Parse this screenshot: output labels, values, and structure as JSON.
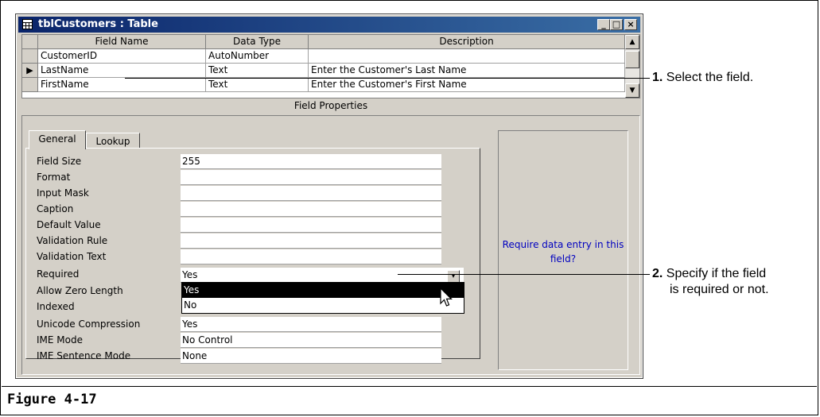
{
  "window": {
    "title": "tblCustomers : Table",
    "minimize_glyph": "_",
    "maximize_glyph": "□",
    "close_glyph": "×"
  },
  "grid": {
    "columns": [
      "Field Name",
      "Data Type",
      "Description"
    ],
    "rows": [
      {
        "field": "CustomerID",
        "type": "AutoNumber",
        "desc": ""
      },
      {
        "field": "LastName",
        "type": "Text",
        "desc": "Enter the Customer's Last Name"
      },
      {
        "field": "FirstName",
        "type": "Text",
        "desc": "Enter the Customer's First Name"
      }
    ],
    "current_row_marker": "▶",
    "scroll_up_glyph": "▲",
    "scroll_down_glyph": "▼"
  },
  "field_properties_label": "Field Properties",
  "tabs": [
    "General",
    "Lookup"
  ],
  "properties": [
    {
      "label": "Field Size",
      "value": "255"
    },
    {
      "label": "Format",
      "value": ""
    },
    {
      "label": "Input Mask",
      "value": ""
    },
    {
      "label": "Caption",
      "value": ""
    },
    {
      "label": "Default Value",
      "value": ""
    },
    {
      "label": "Validation Rule",
      "value": ""
    },
    {
      "label": "Validation Text",
      "value": ""
    },
    {
      "label": "Required",
      "value": "Yes"
    },
    {
      "label": "Allow Zero Length",
      "value": ""
    },
    {
      "label": "Indexed",
      "value": ""
    },
    {
      "label": "Unicode Compression",
      "value": "Yes"
    },
    {
      "label": "IME Mode",
      "value": "No Control"
    },
    {
      "label": "IME Sentence Mode",
      "value": "None"
    }
  ],
  "dropdown": {
    "button_glyph": "▾",
    "options": [
      "Yes",
      "No"
    ],
    "selected": "Yes"
  },
  "help_text": "Require data entry in this field?",
  "callouts": [
    {
      "number": "1.",
      "text": "Select the field."
    },
    {
      "number": "2.",
      "text": "Specify if the field",
      "text2": "is required or not."
    }
  ],
  "figure_label": "Figure 4-17",
  "colors": {
    "title_bar": "#0a246a",
    "dialog_face": "#d4d0c8",
    "selection": "#000000",
    "help_text": "#0000c0"
  }
}
